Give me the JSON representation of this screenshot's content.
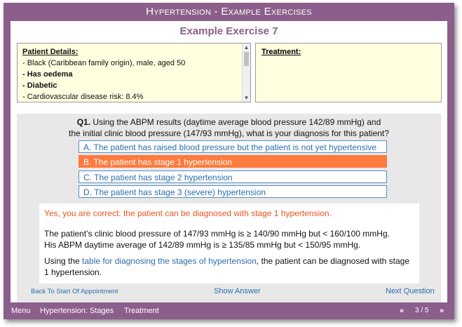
{
  "window": {
    "title": "Hypertension - Example Exercises"
  },
  "exercise": {
    "title": "Example Exercise 7"
  },
  "patient": {
    "heading": "Patient Details:",
    "lines": [
      {
        "text": "- Black (Caribbean family origin), male, aged 50",
        "bold": false
      },
      {
        "text": "- Has oedema",
        "bold": true
      },
      {
        "text": "- Diabetic",
        "bold": true
      },
      {
        "text": "- Cardiovascular disease risk: 8.4%",
        "bold": false
      }
    ]
  },
  "treatment": {
    "heading": "Treatment:"
  },
  "question": {
    "number": "Q1.",
    "text_line1": " Using the ABPM results (daytime average blood pressure 142/89 mmHg) and",
    "text_line2": "the initial clinic blood pressure (147/93 mmHg), what is your diagnosis for this patient?"
  },
  "options": [
    {
      "label": "A. The patient has raised blood pressure but the patient is not yet hypertensive",
      "selected": false
    },
    {
      "label": "B. The patient has stage 1 hypertension",
      "selected": true
    },
    {
      "label": "C. The patient has stage 2 hypertension",
      "selected": false
    },
    {
      "label": "D. The patient has stage 3 (severe) hypertension",
      "selected": false
    }
  ],
  "feedback": {
    "correct": "Yes, you are correct: the patient can be diagnosed with stage 1 hypertension.",
    "para1_line1": "The patient’s clinic blood pressure of 147/93 mmHg is ≥ 140/90 mmHg but < 160/100 mmHg.",
    "para1_line2": "His ABPM daytime average of 142/89 mmHg is ≥ 135/85 mmHg but < 150/95 mmHg.",
    "para2_pre": "Using the ",
    "para2_link": "table for diagnosing the stages of hypertension",
    "para2_post": ", the patient can be diagnosed with stage 1 hypertension."
  },
  "links": {
    "back": "Back To Start Of Appointment",
    "show_answer": "Show Answer",
    "next_question": "Next Question"
  },
  "footer": {
    "menu": "Menu",
    "stages": "Hypertension: Stages",
    "treatment": "Treatment",
    "prev": "«",
    "page": "3 / 5",
    "next": "»"
  },
  "colors": {
    "frame": "#8b5e8b",
    "selected": "#ff7a3d",
    "link": "#2a6fad",
    "correct": "#e8541e"
  }
}
